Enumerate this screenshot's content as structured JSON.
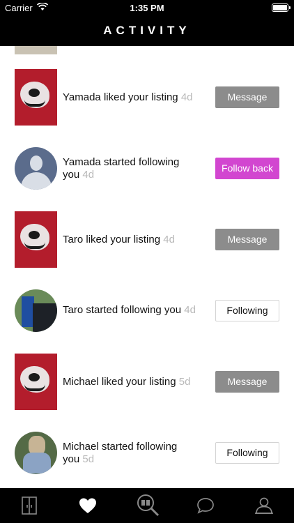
{
  "status_bar": {
    "carrier": "Carrier",
    "time": "1:35 PM"
  },
  "nav": {
    "title": "ACTIVITY"
  },
  "items": [
    {
      "name": "Yamada",
      "action": "liked your listing",
      "ago": "4d",
      "button": "Message",
      "button_style": "message",
      "thumb": "listing-image"
    },
    {
      "name": "Yamada",
      "action": "started following",
      "action_line2": "you",
      "ago": "4d",
      "button": "Follow back",
      "button_style": "follow-back",
      "thumb": "default-avatar"
    },
    {
      "name": "Taro",
      "action": "liked your listing",
      "ago": "4d",
      "button": "Message",
      "button_style": "message",
      "thumb": "listing-image"
    },
    {
      "name": "Taro",
      "action": "started following you",
      "ago": "4d",
      "button": "Following",
      "button_style": "following",
      "thumb": "profile-photo"
    },
    {
      "name": "Michael",
      "action": "liked your listing",
      "ago": "5d",
      "button": "Message",
      "button_style": "message",
      "thumb": "listing-image"
    },
    {
      "name": "Michael",
      "action": "started following",
      "action_line2": "you",
      "ago": "5d",
      "button": "Following",
      "button_style": "following",
      "thumb": "profile-photo"
    }
  ],
  "tab_bar": {
    "tabs": [
      {
        "icon": "closet-icon",
        "active": false
      },
      {
        "icon": "heart-icon",
        "active": true
      },
      {
        "icon": "search-icon",
        "active": false
      },
      {
        "icon": "chat-icon",
        "active": false
      },
      {
        "icon": "profile-icon",
        "active": false
      }
    ]
  },
  "colors": {
    "bar_bg": "#000000",
    "message_button": "#8c8c8c",
    "follow_back_button": "#d246d0",
    "timestamp": "#b9b9b9"
  }
}
